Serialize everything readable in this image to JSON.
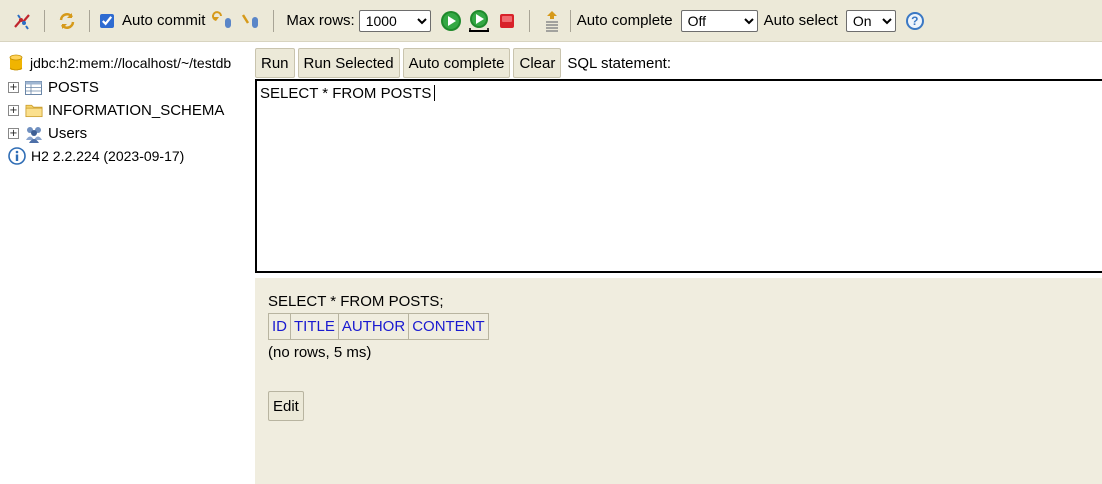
{
  "toolbar": {
    "auto_commit_label": "Auto commit",
    "auto_commit_checked": true,
    "max_rows_label": "Max rows:",
    "max_rows_value": "1000",
    "auto_complete_label": "Auto complete",
    "auto_complete_value": "Off",
    "auto_select_label": "Auto select",
    "auto_select_value": "On",
    "help_glyph": "?"
  },
  "tree": {
    "connection": "jdbc:h2:mem://localhost/~/testdb",
    "items": [
      {
        "label": "POSTS",
        "icon": "table-icon"
      },
      {
        "label": "INFORMATION_SCHEMA",
        "icon": "folder-icon"
      },
      {
        "label": "Users",
        "icon": "users-icon"
      }
    ],
    "version": "H2 2.2.224 (2023-09-17)"
  },
  "buttons": {
    "run": "Run",
    "run_selected": "Run Selected",
    "auto_complete": "Auto complete",
    "clear": "Clear",
    "statement_label": "SQL statement:"
  },
  "editor": {
    "text": "SELECT * FROM POSTS"
  },
  "result": {
    "sql": "SELECT * FROM POSTS;",
    "columns": [
      "ID",
      "TITLE",
      "AUTHOR",
      "CONTENT"
    ],
    "meta": "(no rows, 5 ms)",
    "edit_label": "Edit"
  },
  "colors": {
    "toolbar_bg": "#ece9d8",
    "result_bg": "#f0eddf",
    "column_link": "#1a1ad0"
  }
}
